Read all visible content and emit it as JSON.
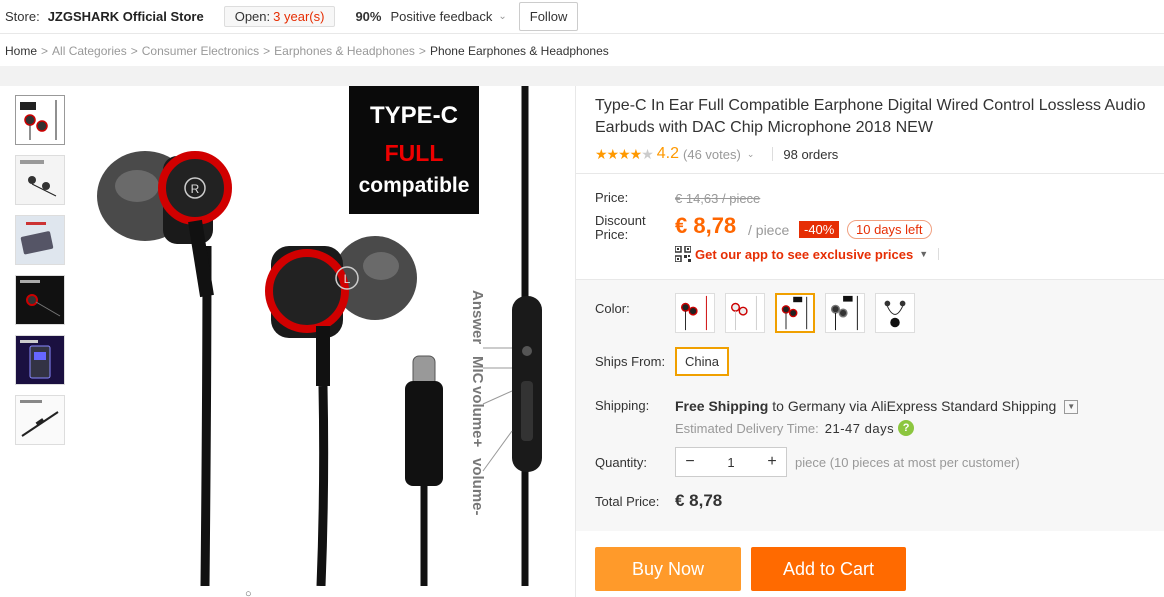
{
  "store": {
    "label": "Store:",
    "name": "JZGSHARK Official Store",
    "open_label": "Open:",
    "open_years": "3 year(s)",
    "feedback_pct": "90%",
    "feedback_label": "Positive feedback",
    "follow_label": "Follow"
  },
  "breadcrumb": [
    "Home",
    "All Categories",
    "Consumer Electronics",
    "Earphones & Headphones",
    "Phone Earphones & Headphones"
  ],
  "breadcrumb_sep": ">",
  "gallery": {
    "thumbnails": [
      "thumb-1",
      "thumb-2",
      "thumb-3",
      "thumb-4",
      "thumb-5",
      "thumb-6"
    ],
    "main_image_text": {
      "line1": "TYPE-C",
      "line2": "FULL",
      "line3": "compatible",
      "controls": [
        "Answer",
        "MIC",
        "volume+",
        "volume-"
      ],
      "left_bud": "R",
      "right_bud": "L"
    },
    "caption": "○"
  },
  "product": {
    "title": "Type-C In Ear Full Compatible Earphone Digital Wired Control Lossless Audio Earbuds with DAC Chip Microphone 2018 NEW",
    "rating": "4.2",
    "stars_filled": "★★★★",
    "stars_empty": "★",
    "votes": "(46 votes)",
    "orders": "98 orders"
  },
  "pricing": {
    "price_label": "Price:",
    "old_price": "€ 14,63 / piece",
    "discount_label": "Discount Price:",
    "discount_price": "€ 8,78",
    "per_piece": "/ piece",
    "discount_pct": "-40%",
    "days_left": "10 days left",
    "app_promo": "Get our app to see exclusive prices"
  },
  "options": {
    "color_label": "Color:",
    "selected_color_index": 2,
    "ships_from_label": "Ships From:",
    "ships_from": "China"
  },
  "shipping": {
    "label": "Shipping:",
    "free": "Free Shipping",
    "to": "to",
    "country": "Germany",
    "via": "via",
    "method": "AliExpress Standard Shipping",
    "eta_label": "Estimated Delivery Time:",
    "eta_days": "21-47 days"
  },
  "quantity": {
    "label": "Quantity:",
    "value": "1",
    "minus": "−",
    "plus": "+",
    "note": "piece (10 pieces at most per customer)"
  },
  "total": {
    "label": "Total Price:",
    "value": "€ 8,78"
  },
  "actions": {
    "buy_now": "Buy Now",
    "add_to_cart": "Add to Cart"
  },
  "colors": {
    "accent_orange": "#ff6a00",
    "buy_orange": "#ff9a2a",
    "red": "#e62e04",
    "select_border": "#f0a000"
  }
}
